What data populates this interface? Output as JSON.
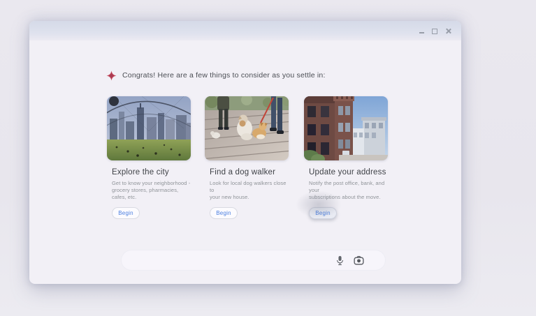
{
  "window": {
    "controls": [
      {
        "name": "minimize"
      },
      {
        "name": "maximize"
      },
      {
        "name": "close"
      }
    ]
  },
  "header": {
    "icon": "assistant-spark-icon",
    "text": "Congrats! Here are a few things to consider as you settle in:"
  },
  "cards": [
    {
      "title": "Explore the city",
      "desc_lines": [
        "Get to know your neighborhood -",
        "grocery stores, pharmacies, cafes, etc."
      ],
      "button_label": "Begin",
      "image": "city-skyline-park-photo",
      "button_state": "default"
    },
    {
      "title": "Find a dog walker",
      "desc_lines": [
        "Look for local dog walkers close to",
        "your new house."
      ],
      "button_label": "Begin",
      "image": "dogs-on-boardwalk-photo",
      "button_state": "default"
    },
    {
      "title": "Update your address",
      "desc_lines": [
        "Notify the post office, bank, and your",
        "subscriptions about the move."
      ],
      "button_label": "Begin",
      "image": "brick-apartment-building-photo",
      "button_state": "hovered"
    }
  ],
  "input_bar": {
    "value": "",
    "placeholder": "",
    "icons": [
      "microphone-icon",
      "camera-icon"
    ]
  },
  "colors": {
    "page_bg": "#e9e7ee",
    "window_bg": "#f2f0f6",
    "titlebar_bg": "#d9ddea",
    "accent_blue": "#4b7fe0",
    "spark_red": "#c64d60",
    "text_primary": "#3f4247",
    "text_secondary": "#8f9398",
    "icon_gray": "#62666c"
  }
}
